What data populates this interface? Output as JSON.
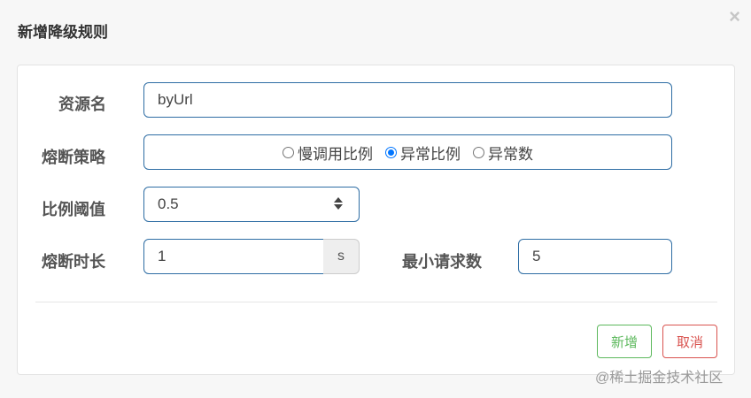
{
  "dialog": {
    "title": "新增降级规则",
    "close_glyph": "×"
  },
  "form": {
    "resource": {
      "label": "资源名",
      "value": "byUrl"
    },
    "strategy": {
      "label": "熔断策略",
      "options": [
        "慢调用比例",
        "异常比例",
        "异常数"
      ],
      "selected": "异常比例"
    },
    "ratio": {
      "label": "比例阈值",
      "value": "0.5"
    },
    "duration": {
      "label": "熔断时长",
      "value": "1",
      "unit": "s"
    },
    "min_requests": {
      "label": "最小请求数",
      "value": "5"
    }
  },
  "footer": {
    "add_label": "新增",
    "cancel_label": "取消"
  },
  "watermark": "@稀土掘金技术社区",
  "colors": {
    "input_border": "#2e6da4",
    "add": "#5cb85c",
    "cancel": "#d9534f",
    "radio_checked": "#0075ff"
  }
}
